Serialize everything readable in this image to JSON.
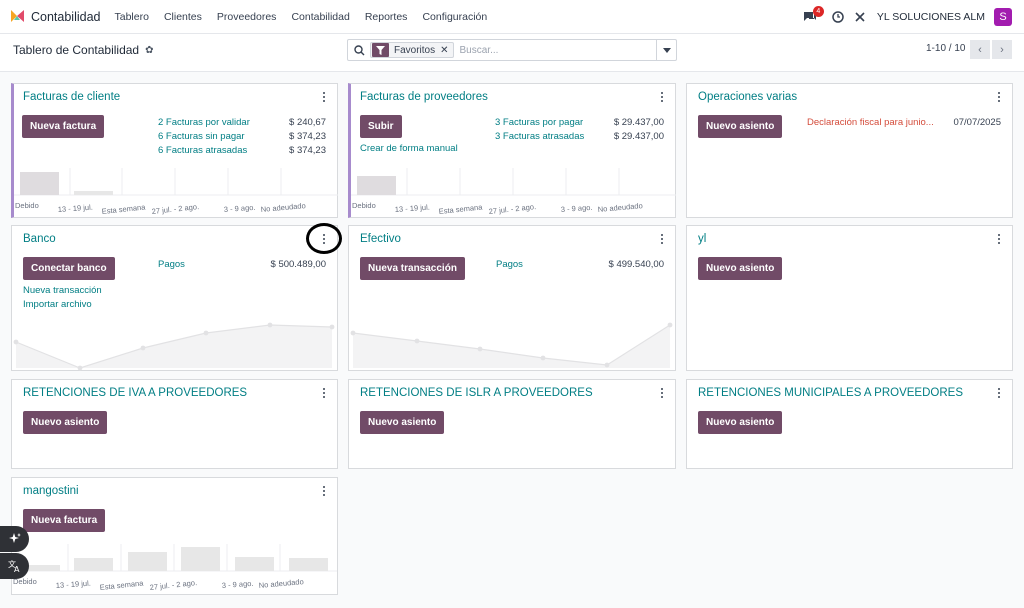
{
  "app": {
    "title": "Contabilidad",
    "menu": [
      "Tablero",
      "Clientes",
      "Proveedores",
      "Contabilidad",
      "Reportes",
      "Configuración"
    ],
    "message_count": "4",
    "company": "YL SOLUCIONES ALM",
    "avatar_letter": "S"
  },
  "control": {
    "breadcrumb": "Tablero de Contabilidad",
    "facet_label": "Favoritos",
    "search_placeholder": "Buscar...",
    "pager": "1-10 / 10"
  },
  "colors": {
    "primary": "#714b67",
    "link": "#017e84",
    "accent_border": "#a78bcd",
    "danger": "#d44c3b"
  },
  "cards": {
    "facturas_cliente": {
      "title": "Facturas de cliente",
      "button": "Nueva factura",
      "stats": [
        {
          "label": "2 Facturas por validar",
          "value": "$ 240,67"
        },
        {
          "label": "6 Facturas sin pagar",
          "value": "$ 374,23"
        },
        {
          "label": "6 Facturas atrasadas",
          "value": "$ 374,23"
        }
      ],
      "chart_labels": [
        "Debido",
        "13 - 19 jul.",
        "Esta semana",
        "27 jul. - 2 ago.",
        "3 - 9 ago.",
        "No adeudado"
      ]
    },
    "facturas_proveedores": {
      "title": "Facturas de proveedores",
      "button": "Subir",
      "manual_link": "Crear de forma manual",
      "stats": [
        {
          "label": "3 Facturas por pagar",
          "value": "$ 29.437,00"
        },
        {
          "label": "3 Facturas atrasadas",
          "value": "$ 29.437,00"
        }
      ],
      "chart_labels": [
        "Debido",
        "13 - 19 jul.",
        "Esta semana",
        "27 jul. - 2 ago.",
        "3 - 9 ago.",
        "No adeudado"
      ]
    },
    "operaciones_varias": {
      "title": "Operaciones varias",
      "button": "Nuevo asiento",
      "item_label": "Declaración fiscal para junio...",
      "item_date": "07/07/2025"
    },
    "banco": {
      "title": "Banco",
      "button": "Conectar banco",
      "payments_label": "Pagos",
      "payments_value": "$ 500.489,00",
      "link1": "Nueva transacción",
      "link2": "Importar archivo"
    },
    "efectivo": {
      "title": "Efectivo",
      "button": "Nueva transacción",
      "payments_label": "Pagos",
      "payments_value": "$ 499.540,00"
    },
    "yl": {
      "title": "yl",
      "button": "Nuevo asiento"
    },
    "ret_iva": {
      "title": "RETENCIONES DE IVA A PROVEEDORES",
      "button": "Nuevo asiento"
    },
    "ret_islr": {
      "title": "RETENCIONES DE ISLR A PROVEEDORES",
      "button": "Nuevo asiento"
    },
    "ret_municipales": {
      "title": "RETENCIONES MUNICIPALES A PROVEEDORES",
      "button": "Nuevo asiento"
    },
    "mangostini": {
      "title": "mangostini",
      "button": "Nueva factura",
      "chart_labels": [
        "Debido",
        "13 - 19 jul.",
        "Esta semana",
        "27 jul. - 2 ago.",
        "3 - 9 ago.",
        "No adeudado"
      ]
    }
  },
  "icons": {
    "logo": "accounting-logo-icon",
    "chat": "chat-icon",
    "activity": "clock-icon",
    "tools": "tools-icon",
    "settings": "gear-icon",
    "search": "search-icon",
    "filter": "filter-icon",
    "ai": "sparkle-icon",
    "translate": "translate-icon"
  }
}
